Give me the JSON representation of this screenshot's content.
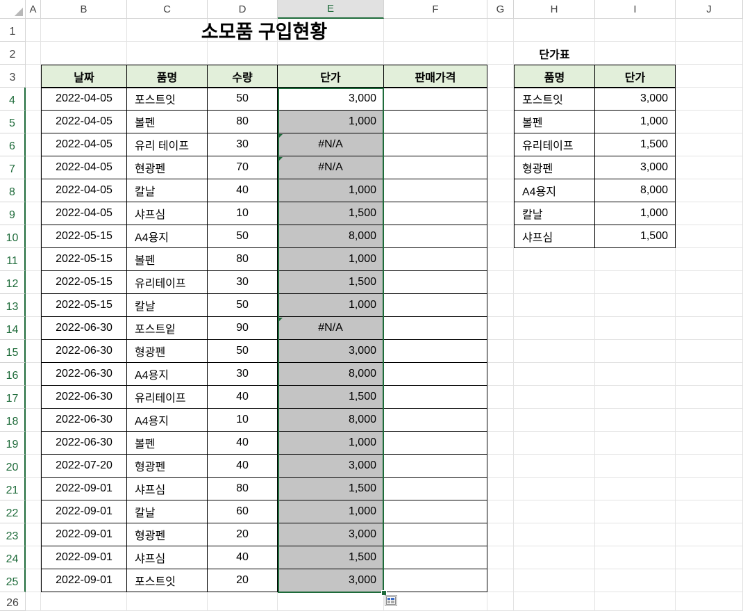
{
  "columns": [
    "A",
    "B",
    "C",
    "D",
    "E",
    "F",
    "G",
    "H",
    "I",
    "J"
  ],
  "rows": [
    "1",
    "2",
    "3",
    "4",
    "5",
    "6",
    "7",
    "8",
    "9",
    "10",
    "11",
    "12",
    "13",
    "14",
    "15",
    "16",
    "17",
    "18",
    "19",
    "20",
    "21",
    "22",
    "23",
    "24",
    "25",
    "26"
  ],
  "title": "소모품 구입현황",
  "main_table": {
    "headers": [
      "날짜",
      "품명",
      "수량",
      "단가",
      "판매가격"
    ],
    "rows": [
      [
        "2022-04-05",
        "포스트잇",
        "50",
        "3,000",
        ""
      ],
      [
        "2022-04-05",
        "볼펜",
        "80",
        "1,000",
        ""
      ],
      [
        "2022-04-05",
        "유리 테이프",
        "30",
        "#N/A",
        ""
      ],
      [
        "2022-04-05",
        "현광펜",
        "70",
        "#N/A",
        ""
      ],
      [
        "2022-04-05",
        "칼날",
        "40",
        "1,000",
        ""
      ],
      [
        "2022-04-05",
        "샤프심",
        "10",
        "1,500",
        ""
      ],
      [
        "2022-05-15",
        "A4용지",
        "50",
        "8,000",
        ""
      ],
      [
        "2022-05-15",
        "볼펜",
        "80",
        "1,000",
        ""
      ],
      [
        "2022-05-15",
        "유리테이프",
        "30",
        "1,500",
        ""
      ],
      [
        "2022-05-15",
        "칼날",
        "50",
        "1,000",
        ""
      ],
      [
        "2022-06-30",
        "포스트잍",
        "90",
        "#N/A",
        ""
      ],
      [
        "2022-06-30",
        "형광펜",
        "50",
        "3,000",
        ""
      ],
      [
        "2022-06-30",
        "A4용지",
        "30",
        "8,000",
        ""
      ],
      [
        "2022-06-30",
        "유리테이프",
        "40",
        "1,500",
        ""
      ],
      [
        "2022-06-30",
        "A4용지",
        "10",
        "8,000",
        ""
      ],
      [
        "2022-06-30",
        "볼펜",
        "40",
        "1,000",
        ""
      ],
      [
        "2022-07-20",
        "형광펜",
        "40",
        "3,000",
        ""
      ],
      [
        "2022-09-01",
        "샤프심",
        "80",
        "1,500",
        ""
      ],
      [
        "2022-09-01",
        "칼날",
        "60",
        "1,000",
        ""
      ],
      [
        "2022-09-01",
        "형광펜",
        "20",
        "3,000",
        ""
      ],
      [
        "2022-09-01",
        "샤프심",
        "40",
        "1,500",
        ""
      ],
      [
        "2022-09-01",
        "포스트잇",
        "20",
        "3,000",
        ""
      ]
    ]
  },
  "price_table": {
    "title": "단가표",
    "headers": [
      "품명",
      "단가"
    ],
    "rows": [
      [
        "포스트잇",
        "3,000"
      ],
      [
        "볼펜",
        "1,000"
      ],
      [
        "유리테이프",
        "1,500"
      ],
      [
        "형광펜",
        "3,000"
      ],
      [
        "A4용지",
        "8,000"
      ],
      [
        "칼날",
        "1,000"
      ],
      [
        "샤프심",
        "1,500"
      ]
    ]
  },
  "selected_column": "E",
  "selected_rows_from": 4,
  "selected_rows_to": 25,
  "colors": {
    "header_fill": "#e2efda",
    "selection_fill": "#c4c4c4",
    "accent": "#1e6b3a"
  },
  "icons": {
    "quick_analysis": "quick-analysis-icon",
    "error_indicator": "error-triangle-icon"
  }
}
